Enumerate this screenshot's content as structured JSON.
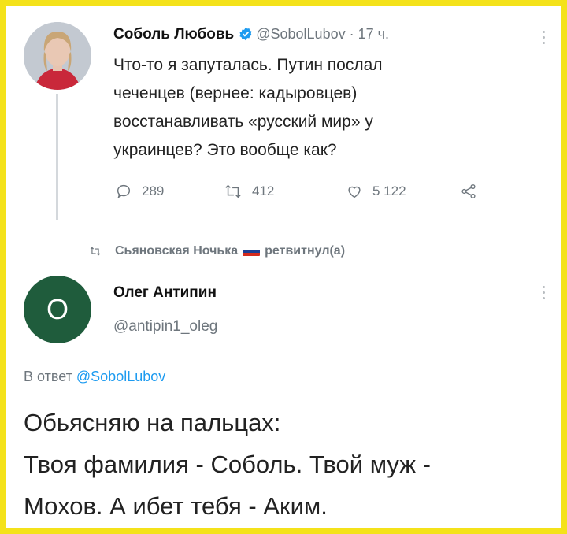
{
  "tweet1": {
    "author_name": "Соболь Любовь",
    "handle": "@SobolLubov",
    "separator": " · ",
    "time": "17 ч.",
    "lines": [
      "Что-то я запуталась. Путин послал",
      "чеченцев (вернее: кадыровцев)",
      "восстанавливать «русский мир» у",
      "украинцев? Это вообще как?"
    ],
    "reply_count": "289",
    "retweet_count": "412",
    "like_count": "5 122"
  },
  "retweet_banner": {
    "user": "Сьяновская Ночька",
    "action": "ретвитнул(а)"
  },
  "tweet2": {
    "avatar_letter": "О",
    "author_name": "Олег Антипин",
    "handle": "@antipin1_oleg",
    "reply_prefix": "В ответ ",
    "reply_to_handle": "@SobolLubov",
    "lines": [
      "Обьясняю на пальцах:",
      "Твоя фамилия - Соболь. Твой муж -",
      "Мохов. А ибет тебя - Аким."
    ]
  },
  "colors": {
    "frame": "#f4e21a",
    "link": "#1d9bf0",
    "verified": "#1d9bf0",
    "avatar2_bg": "#1f5c3c",
    "muted": "#6e767d"
  }
}
